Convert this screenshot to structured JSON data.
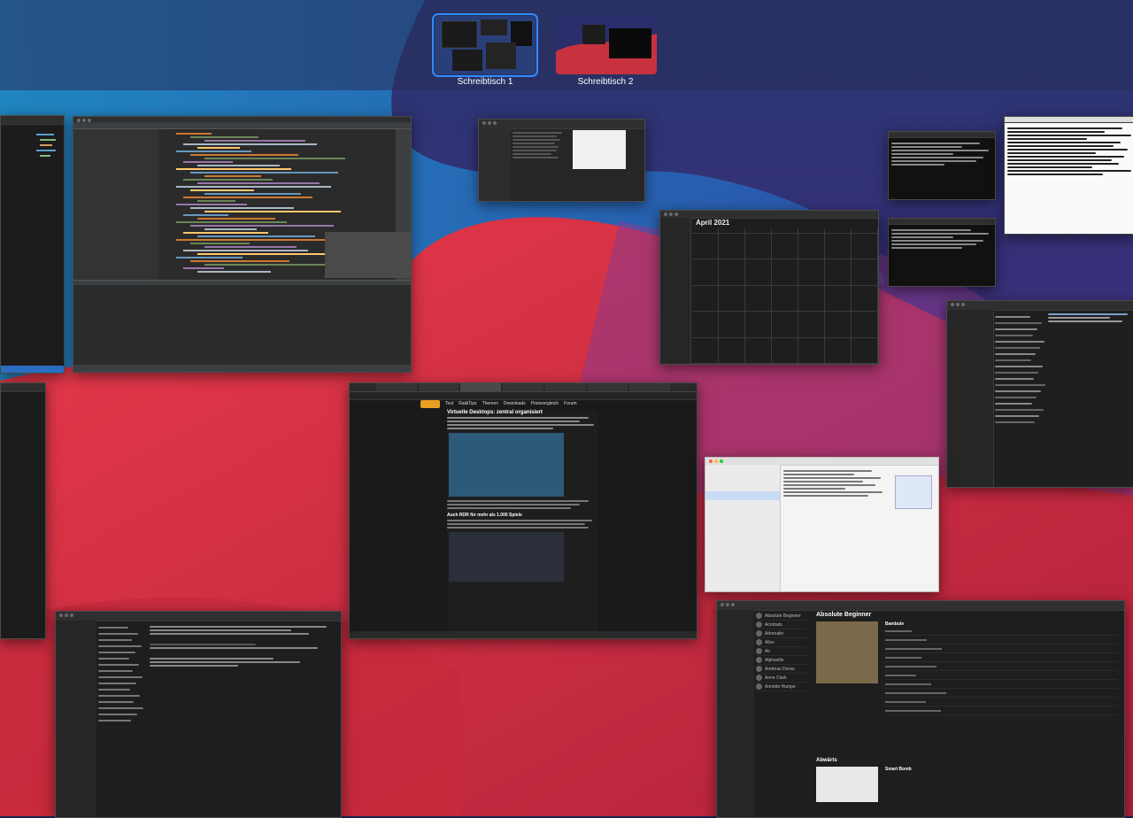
{
  "spaces": [
    {
      "label": "Schreibtisch 1",
      "selected": true
    },
    {
      "label": "Schreibtisch 2",
      "selected": false
    }
  ],
  "calendar": {
    "title": "April 2021"
  },
  "browser": {
    "headline": "Virtuelle Desktops: zentral organisiert",
    "section": "Auch RDR für mehr als 1.000 Spiele",
    "nav": [
      "Test",
      "Rat&Tips",
      "Themen",
      "Downloads",
      "Preisvergleich",
      "Forum"
    ]
  },
  "music": {
    "album_title": "Absolute Beginner",
    "artist": "Bambule",
    "section2": "Abwärts",
    "section2_album": "Smart Bomb",
    "sidebar": [
      "Absolute Beginner",
      "Acrobats",
      "Adrenalin",
      "Alice",
      "Air",
      "Alphaville",
      "Andreas Dorau",
      "Anne Clark",
      "Annette Humpe"
    ]
  },
  "icons": [
    "apple-icon",
    "gear-icon",
    "search-icon"
  ]
}
